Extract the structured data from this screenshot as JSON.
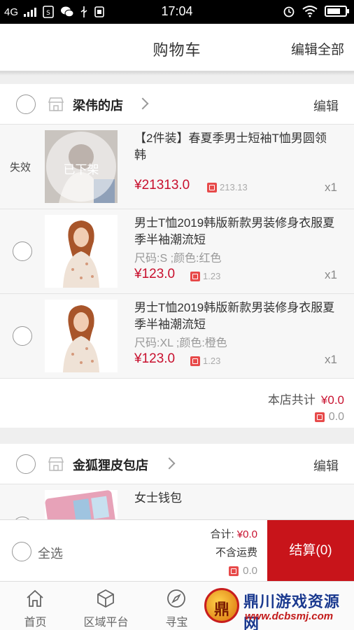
{
  "status_bar": {
    "network": "4G",
    "time": "17:04"
  },
  "header": {
    "title": "购物车",
    "edit_all": "编辑全部"
  },
  "stores": [
    {
      "name": "梁伟的店",
      "edit": "编辑",
      "items": [
        {
          "status_label": "失效",
          "overlay": "已下架",
          "title": "【2件装】春夏季男士短袖T恤男圆领韩",
          "price": "¥21313.0",
          "points": "213.13",
          "qty": "x1"
        },
        {
          "title": "男士T恤2019韩版新款男装修身衣服夏季半袖潮流短",
          "spec": "尺码:S ;颜色:红色",
          "price": "¥123.0",
          "points": "1.23",
          "qty": "x1"
        },
        {
          "title": "男士T恤2019韩版新款男装修身衣服夏季半袖潮流短",
          "spec": "尺码:XL ;颜色:橙色",
          "price": "¥123.0",
          "points": "1.23",
          "qty": "x1"
        }
      ],
      "total_label": "本店共计",
      "total_amount": "¥0.0",
      "total_points": "0.0"
    },
    {
      "name": "金狐狸皮包店",
      "edit": "编辑",
      "items": [
        {
          "title": "女士钱包"
        }
      ]
    }
  ],
  "checkout": {
    "select_all": "全选",
    "sum_label": "合计:",
    "sum_amount": "¥0.0",
    "shipping_note": "不含运费",
    "points": "0.0",
    "pay_button": "结算(0)"
  },
  "tabs": [
    {
      "label": "首页",
      "icon": "home-icon"
    },
    {
      "label": "区域平台",
      "icon": "cube-icon"
    },
    {
      "label": "寻宝",
      "icon": "compass-icon"
    }
  ],
  "watermark": {
    "title": "鼎川游戏资源网",
    "url": "www.dcbsmj.com"
  },
  "colors": {
    "accent": "#c8141a",
    "price": "#c8102e"
  }
}
